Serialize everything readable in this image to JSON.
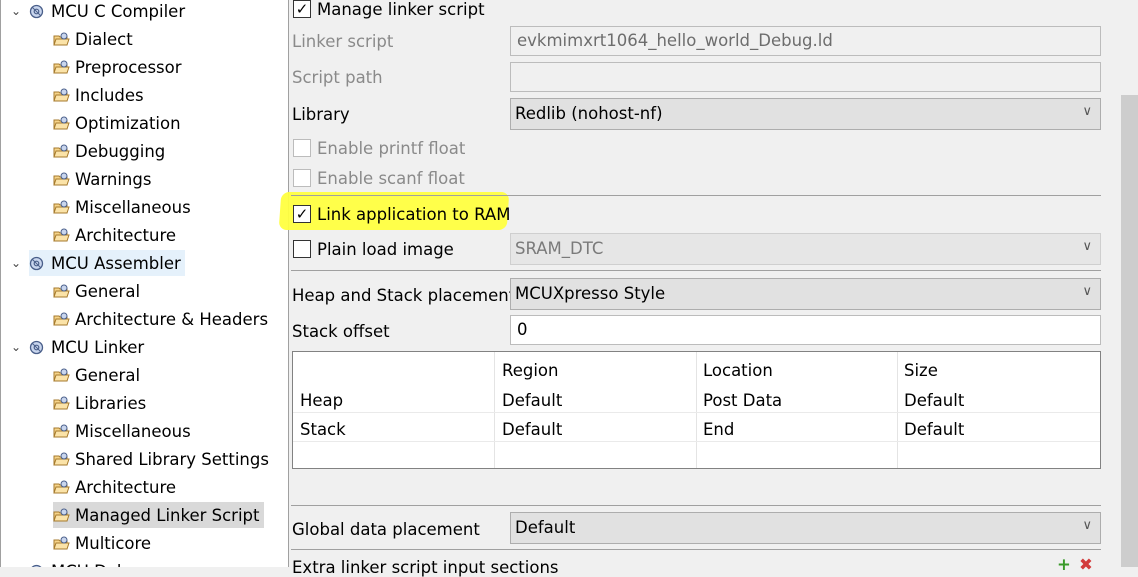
{
  "tree": [
    {
      "label": "MCU C Compiler",
      "level": 0,
      "expanded": true
    },
    {
      "label": "Dialect",
      "level": 1
    },
    {
      "label": "Preprocessor",
      "level": 1
    },
    {
      "label": "Includes",
      "level": 1
    },
    {
      "label": "Optimization",
      "level": 1
    },
    {
      "label": "Debugging",
      "level": 1
    },
    {
      "label": "Warnings",
      "level": 1
    },
    {
      "label": "Miscellaneous",
      "level": 1
    },
    {
      "label": "Architecture",
      "level": 1
    },
    {
      "label": "MCU Assembler",
      "level": 0,
      "expanded": true,
      "hover": true
    },
    {
      "label": "General",
      "level": 1
    },
    {
      "label": "Architecture & Headers",
      "level": 1
    },
    {
      "label": "MCU Linker",
      "level": 0,
      "expanded": true
    },
    {
      "label": "General",
      "level": 1
    },
    {
      "label": "Libraries",
      "level": 1
    },
    {
      "label": "Miscellaneous",
      "level": 1
    },
    {
      "label": "Shared Library Settings",
      "level": 1
    },
    {
      "label": "Architecture",
      "level": 1
    },
    {
      "label": "Managed Linker Script",
      "level": 1,
      "selected": true
    },
    {
      "label": "Multicore",
      "level": 1
    },
    {
      "label": "MCU Debugger",
      "level": 0
    }
  ],
  "form": {
    "manage_linker_script": "Manage linker script",
    "linker_script_label": "Linker script",
    "linker_script_value": "evkmimxrt1064_hello_world_Debug.ld",
    "script_path_label": "Script path",
    "script_path_value": "",
    "library_label": "Library",
    "library_value": "Redlib (nohost-nf)",
    "enable_printf_float": "Enable printf float",
    "enable_scanf_float": "Enable scanf float",
    "link_to_ram": "Link application to RAM",
    "plain_load_image": "Plain load image",
    "plain_load_value": "SRAM_DTC",
    "heap_stack_label": "Heap and Stack placement",
    "heap_stack_value": "MCUXpresso Style",
    "stack_offset_label": "Stack offset",
    "stack_offset_value": "0",
    "global_data_label": "Global data placement",
    "global_data_value": "Default",
    "extra_sections_label": "Extra linker script input sections"
  },
  "table": {
    "headers": [
      "",
      "Region",
      "Location",
      "Size"
    ],
    "rows": [
      [
        "Heap",
        "Default",
        "Post Data",
        "Default"
      ],
      [
        "Stack",
        "Default",
        "End",
        "Default"
      ]
    ]
  }
}
